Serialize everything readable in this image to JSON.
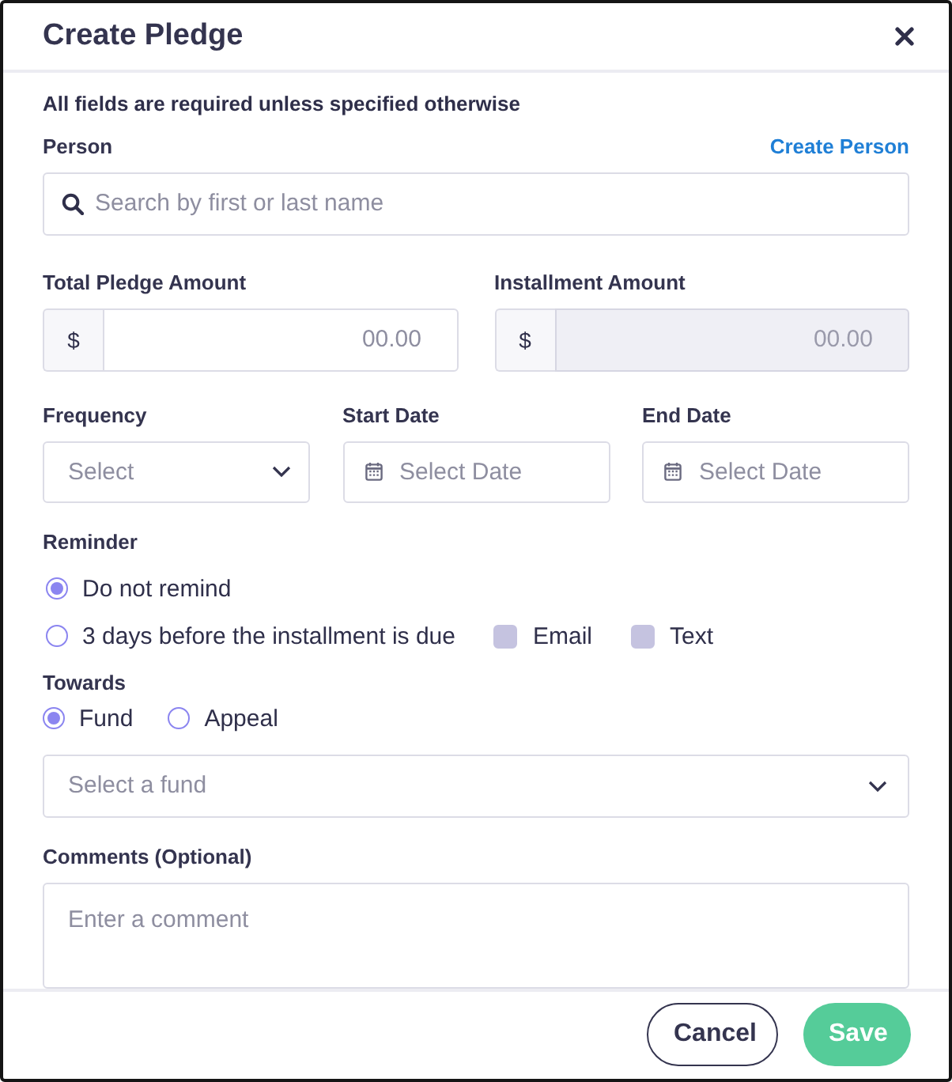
{
  "dialog": {
    "title": "Create Pledge"
  },
  "note": "All fields are required unless specified otherwise",
  "person": {
    "label": "Person",
    "link": "Create Person",
    "placeholder": "Search by first or last name"
  },
  "amounts": [
    {
      "label": "Total Pledge Amount",
      "prefix": "$",
      "placeholder": "00.00",
      "disabled": false
    },
    {
      "label": "Installment Amount",
      "prefix": "$",
      "placeholder": "00.00",
      "disabled": true
    }
  ],
  "schedule": [
    {
      "kind": "select",
      "label": "Frequency",
      "placeholder": "Select"
    },
    {
      "kind": "date",
      "label": "Start Date",
      "placeholder": "Select Date"
    },
    {
      "kind": "date",
      "label": "End Date",
      "placeholder": "Select Date"
    }
  ],
  "reminder": {
    "label": "Reminder",
    "options": [
      {
        "label": "Do not remind",
        "selected": true
      },
      {
        "label": "3 days before the installment is due",
        "selected": false,
        "channels": [
          {
            "label": "Email",
            "checked": false,
            "disabled": true
          },
          {
            "label": "Text",
            "checked": false,
            "disabled": true
          }
        ]
      }
    ]
  },
  "towards": {
    "label": "Towards",
    "options": [
      {
        "label": "Fund",
        "selected": true
      },
      {
        "label": "Appeal",
        "selected": false
      }
    ],
    "select": {
      "placeholder": "Select a fund"
    }
  },
  "comments": {
    "label": "Comments (Optional)",
    "placeholder": "Enter a comment"
  },
  "buttons": [
    {
      "kind": "secondary",
      "label": "Cancel"
    },
    {
      "kind": "primary",
      "label": "Save"
    }
  ]
}
